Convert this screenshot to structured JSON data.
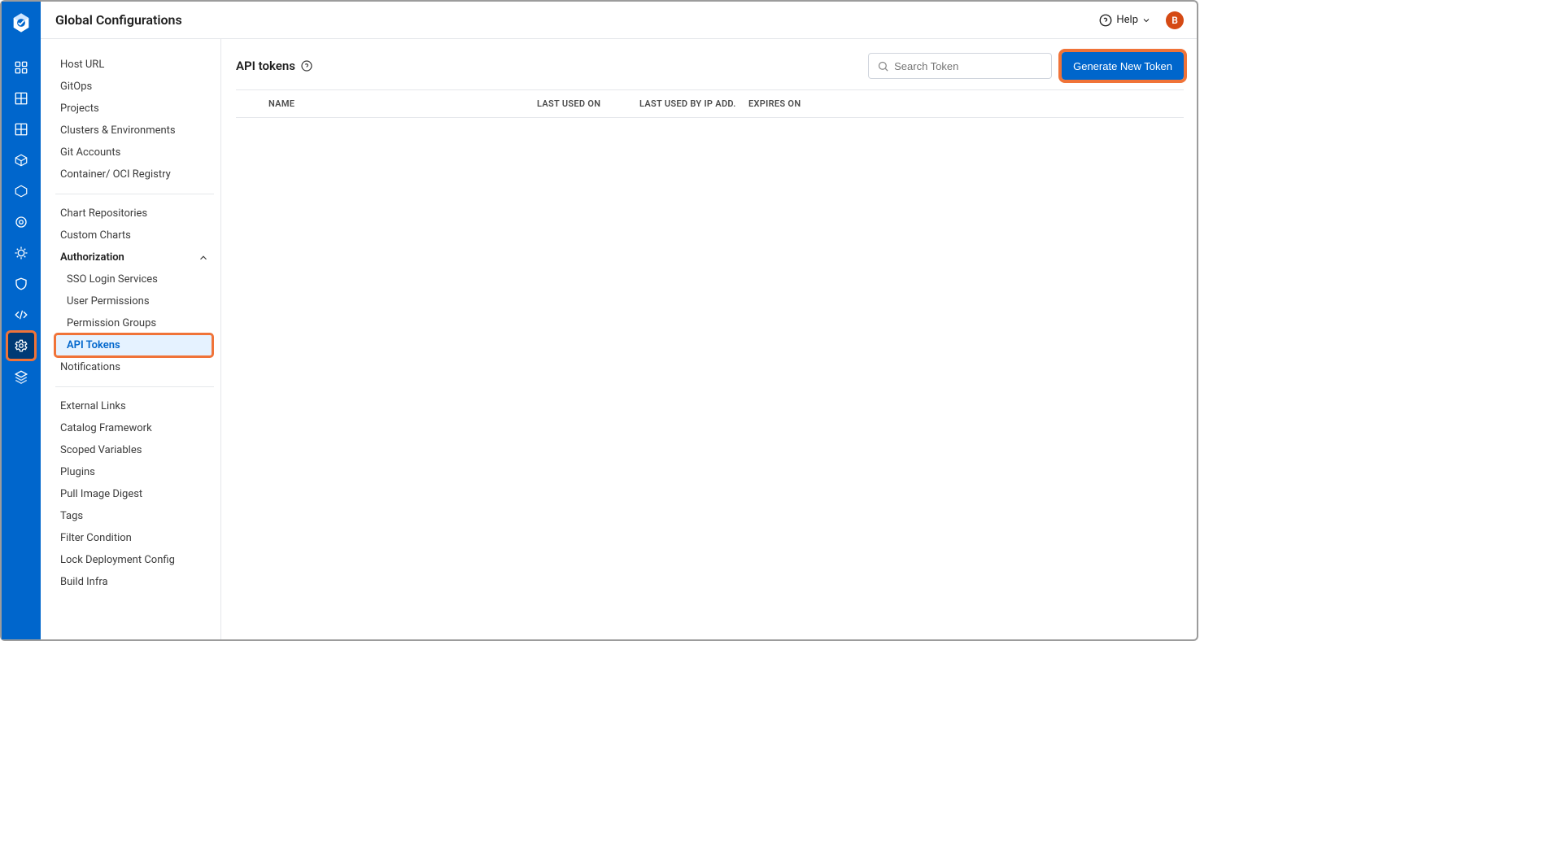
{
  "header": {
    "title": "Global Configurations",
    "help_label": "Help",
    "avatar_initial": "B"
  },
  "rail": {
    "items": [
      {
        "name": "logo"
      },
      {
        "name": "grid-apps"
      },
      {
        "name": "build-grid"
      },
      {
        "name": "package"
      },
      {
        "name": "cube-registry"
      },
      {
        "name": "cube"
      },
      {
        "name": "target"
      },
      {
        "name": "gear-tune"
      },
      {
        "name": "shield"
      },
      {
        "name": "code"
      },
      {
        "name": "settings",
        "active": true
      },
      {
        "name": "layers"
      }
    ]
  },
  "sidenav": {
    "group1": [
      {
        "label": "Host URL"
      },
      {
        "label": "GitOps"
      },
      {
        "label": "Projects"
      },
      {
        "label": "Clusters & Environments"
      },
      {
        "label": "Git Accounts"
      },
      {
        "label": "Container/ OCI Registry"
      }
    ],
    "group2": [
      {
        "label": "Chart Repositories"
      },
      {
        "label": "Custom Charts"
      }
    ],
    "authorization_label": "Authorization",
    "authorization_children": [
      {
        "label": "SSO Login Services"
      },
      {
        "label": "User Permissions"
      },
      {
        "label": "Permission Groups"
      },
      {
        "label": "API Tokens",
        "selected": true
      }
    ],
    "group3_tail": [
      {
        "label": "Notifications"
      }
    ],
    "group4": [
      {
        "label": "External Links"
      },
      {
        "label": "Catalog Framework"
      },
      {
        "label": "Scoped Variables"
      },
      {
        "label": "Plugins"
      },
      {
        "label": "Pull Image Digest"
      },
      {
        "label": "Tags"
      },
      {
        "label": "Filter Condition"
      },
      {
        "label": "Lock Deployment Config"
      },
      {
        "label": "Build Infra"
      }
    ]
  },
  "content": {
    "title": "API tokens",
    "search_placeholder": "Search Token",
    "primary_button": "Generate New Token",
    "columns": {
      "name": "NAME",
      "last_used": "LAST USED ON",
      "last_ip": "LAST USED BY IP ADD.",
      "expires": "EXPIRES ON"
    },
    "rows": []
  }
}
